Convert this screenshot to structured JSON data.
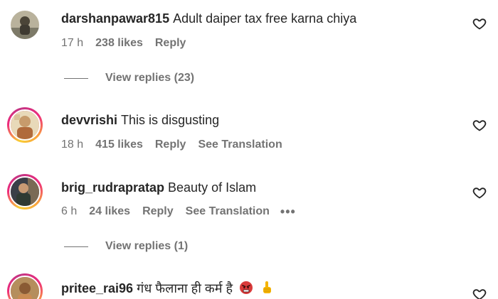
{
  "comments": [
    {
      "username": "darshanpawar815",
      "text": "Adult daiper tax free karna chiya",
      "time": "17 h",
      "likes": "238 likes",
      "reply": "Reply",
      "translation": "",
      "view_replies": "View replies (23)",
      "avatar_icon": "avatar-photo-icon",
      "has_story_ring": false
    },
    {
      "username": "devvrishi",
      "text": "This is disgusting",
      "time": "18 h",
      "likes": "415 likes",
      "reply": "Reply",
      "translation": "See Translation",
      "view_replies": "",
      "avatar_icon": "avatar-photo-icon",
      "has_story_ring": true
    },
    {
      "username": "brig_rudrapratap",
      "text": "Beauty of Islam",
      "time": "6 h",
      "likes": "24 likes",
      "reply": "Reply",
      "translation": "See Translation",
      "more": "•••",
      "view_replies": "View replies (1)",
      "avatar_icon": "avatar-photo-icon",
      "has_story_ring": true
    },
    {
      "username": "pritee_rai96",
      "text": "गंध फैलाना ही कर्म है",
      "emojis": [
        "angry-face-emoji",
        "pointing-up-emoji"
      ],
      "avatar_icon": "avatar-photo-icon",
      "has_story_ring": true
    }
  ],
  "icons": {
    "like": "heart-outline-icon"
  },
  "colors": {
    "text_primary": "#262626",
    "text_secondary": "#737373",
    "ring_gradient": [
      "#f9ce34",
      "#ee2a7b",
      "#c13584"
    ]
  }
}
